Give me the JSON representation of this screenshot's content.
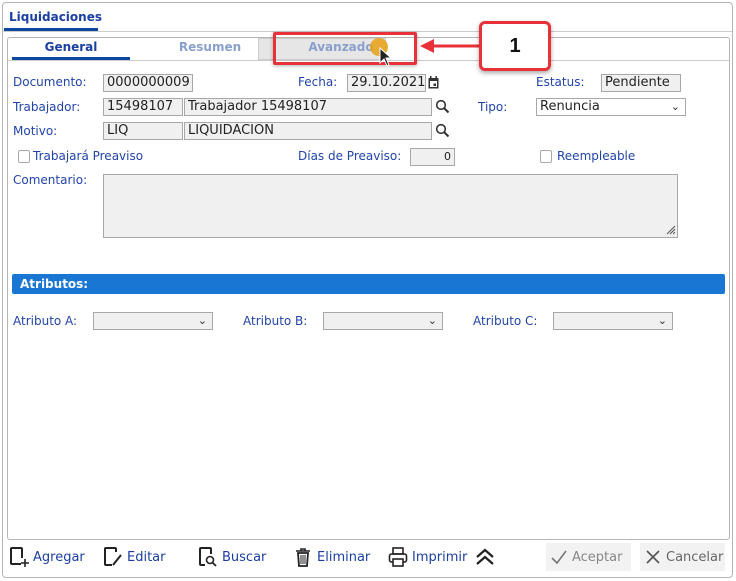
{
  "window": {
    "title": "Liquidaciones"
  },
  "tabs": [
    {
      "label": "General",
      "active": true
    },
    {
      "label": "Resumen",
      "active": false
    },
    {
      "label": "Avanzado",
      "active": false,
      "highlighted": true
    }
  ],
  "callout": {
    "number": "1",
    "color": "#e8323a"
  },
  "form": {
    "documento": {
      "label": "Documento:",
      "value": "0000000009"
    },
    "fecha": {
      "label": "Fecha:",
      "value": "29.10.2021"
    },
    "estatus": {
      "label": "Estatus:",
      "value": "Pendiente"
    },
    "trabajador": {
      "label": "Trabajador:",
      "code": "15498107",
      "name": "Trabajador 15498107"
    },
    "tipo": {
      "label": "Tipo:",
      "value": "Renuncia"
    },
    "motivo": {
      "label": "Motivo:",
      "code": "LIQ",
      "name": "LIQUIDACION"
    },
    "preaviso": {
      "label": "Trabajará Preaviso",
      "checked": false
    },
    "dias_preaviso": {
      "label": "Días de Preaviso:",
      "value": "0"
    },
    "reempleable": {
      "label": "Reempleable",
      "checked": false
    },
    "comentario": {
      "label": "Comentario:",
      "value": ""
    }
  },
  "atributos": {
    "title": "Atributos:",
    "color": "#1976d2",
    "a": {
      "label": "Atributo A:",
      "value": ""
    },
    "b": {
      "label": "Atributo B:",
      "value": ""
    },
    "c": {
      "label": "Atributo C:",
      "value": ""
    }
  },
  "toolbar": {
    "agregar": "Agregar",
    "editar": "Editar",
    "buscar": "Buscar",
    "eliminar": "Eliminar",
    "imprimir": "Imprimir",
    "aceptar": "Aceptar",
    "cancelar": "Cancelar"
  }
}
